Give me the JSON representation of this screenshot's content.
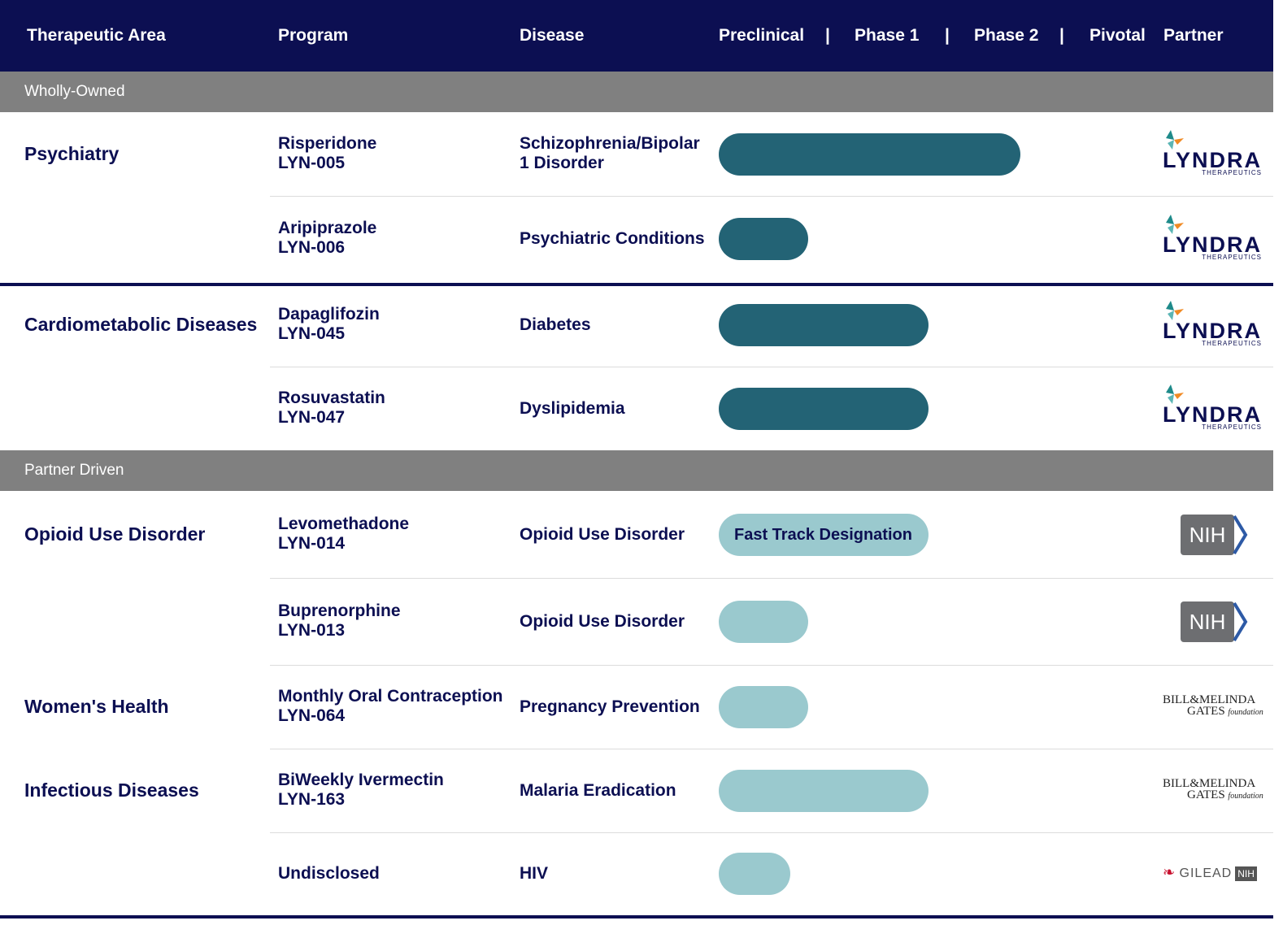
{
  "chart_data": {
    "type": "table",
    "columns": [
      "Therapeutic Area",
      "Program",
      "Disease",
      "Preclinical",
      "Phase 1",
      "Phase 2",
      "Pivotal",
      "Partner"
    ],
    "stage_separator": "|",
    "bar_color_wholly_owned": "#236375",
    "bar_color_partner_driven": "#9ac9ce",
    "header_color": "#0c0f52",
    "section_color": "#808080",
    "sections": [
      {
        "label": "Wholly-Owned",
        "rows": [
          {
            "area": "Psychiatry",
            "program": "Risperidone",
            "code": "LYN-005",
            "disease": "Schizophrenia/Bipolar 1 Disorder",
            "progress": 2.65,
            "bar_label": "",
            "partner": "LYNDRA",
            "partner_sub": "THERAPEUTICS"
          },
          {
            "area": "",
            "program": "Aripiprazole",
            "code": "LYN-006",
            "disease": "Psychiatric Conditions",
            "progress": 0.83,
            "bar_label": "",
            "partner": "LYNDRA",
            "partner_sub": "THERAPEUTICS"
          },
          {
            "area": "Cardiometabolic Diseases",
            "program": "Dapaglifozin",
            "code": "LYN-045",
            "disease": "Diabetes",
            "progress": 1.82,
            "bar_label": "",
            "partner": "LYNDRA",
            "partner_sub": "THERAPEUTICS"
          },
          {
            "area": "",
            "program": "Rosuvastatin",
            "code": "LYN-047",
            "disease": "Dyslipidemia",
            "progress": 1.82,
            "bar_label": "",
            "partner": "LYNDRA",
            "partner_sub": "THERAPEUTICS"
          }
        ]
      },
      {
        "label": "Partner Driven",
        "rows": [
          {
            "area": "Opioid Use Disorder",
            "program": "Levomethadone",
            "code": "LYN-014",
            "disease": "Opioid Use Disorder",
            "progress": 1.82,
            "bar_label": "Fast Track Designation",
            "partner": "NIH"
          },
          {
            "area": "",
            "program": "Buprenorphine",
            "code": "LYN-013",
            "disease": "Opioid Use Disorder",
            "progress": 0.83,
            "bar_label": "",
            "partner": "NIH"
          },
          {
            "area": "Women's Health",
            "program": "Monthly Oral Contraception",
            "code": "LYN-064",
            "disease": "Pregnancy Prevention",
            "progress": 0.83,
            "bar_label": "",
            "partner": "BILL&MELINDA GATES foundation"
          },
          {
            "area": "Infectious Diseases",
            "program": "BiWeekly Ivermectin",
            "code": "LYN-163",
            "disease": "Malaria Eradication",
            "progress": 1.82,
            "bar_label": "",
            "partner": "BILL&MELINDA GATES foundation"
          },
          {
            "area": "",
            "program": "Undisclosed",
            "code": "",
            "disease": "HIV",
            "progress": 0.67,
            "bar_label": "",
            "partner": "GILEAD NIH"
          }
        ]
      }
    ]
  }
}
